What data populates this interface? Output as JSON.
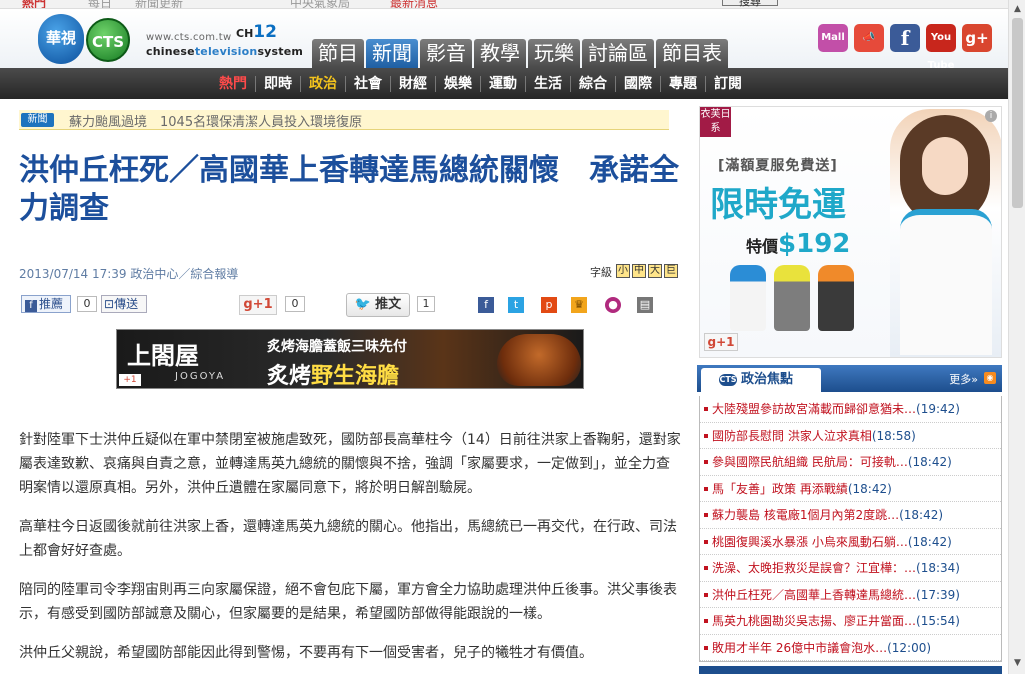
{
  "top_strip": {
    "items": [
      "熱門",
      "每日",
      "新聞更新",
      "中央氣象局",
      "最新消息"
    ],
    "search_label": "搜尋"
  },
  "logo": {
    "huashi": "華視",
    "cts": "CTS",
    "url": "www.cts.com.tw",
    "channel_prefix": "CH",
    "channel_number": "12",
    "name_prefix": "chinese",
    "name_mid": "television",
    "name_suffix": "system"
  },
  "main_tabs": [
    "節目",
    "新聞",
    "影音",
    "教學",
    "玩樂",
    "討論區",
    "節目表"
  ],
  "active_tab": "新聞",
  "social": {
    "mall": "Mall",
    "horn": "📣",
    "fb": "f",
    "yt": "You Tube",
    "gp": "g+"
  },
  "sub_nav": [
    "熱門",
    "即時",
    "政治",
    "社會",
    "財經",
    "娛樂",
    "運動",
    "生活",
    "綜合",
    "國際",
    "專題",
    "訂閱"
  ],
  "ticker": {
    "badge": "新聞",
    "text": "蘇力颱風過境　1045名環保清潔人員投入環境復原"
  },
  "article": {
    "headline": "洪仲丘枉死／高國華上香轉達馬總統關懷　承諾全力調查",
    "meta": "2013/07/14 17:39 政治中心／綜合報導",
    "font_label": "字級",
    "font_sizes": [
      "小",
      "中",
      "大",
      "巨"
    ],
    "fb_label": "推薦",
    "fb_count": "0",
    "share_label": "傳送",
    "gplus_label": "+1",
    "gplus_count": "0",
    "tweet_label": "推文",
    "tweet_count": "1",
    "paragraphs": [
      "針對陸軍下士洪仲丘疑似在軍中禁閉室被施虐致死，國防部長高華柱今（14）日前往洪家上香鞠躬，還對家屬表達致歉、哀痛與自責之意，並轉達馬英九總統的關懷與不捨，強調「家屬要求，一定做到」，並全力查明案情以還原真相。另外，洪仲丘遺體在家屬同意下，將於明日解剖驗屍。",
      "高華柱今日返國後就前往洪家上香，還轉達馬英九總統的關心。他指出，馬總統已一再交代，在行政、司法上都會好好查處。",
      "陪同的陸軍司令李翔宙則再三向家屬保證，絕不會包庇下屬，軍方會全力協助處理洪仲丘後事。洪父事後表示，有感受到國防部誠意及關心，但家屬要的是結果，希望國防部做得能跟說的一樣。",
      "洪仲丘父親說，希望國防部能因此得到警惕，不要再有下一個受害者，兒子的犧牲才有價值。"
    ]
  },
  "banner": {
    "brand": "上閤屋",
    "brand_en": "JOGOYA",
    "line1": "炙烤海膽蓋飯三味先付",
    "line2_a": "炙烤",
    "line2_b": "野生海膽",
    "gplus": "+1"
  },
  "ad": {
    "tag": "衣芙日系",
    "line1": "[滿額夏服免費送]",
    "line2": "限時免運",
    "price_label": "特價",
    "price": "$192",
    "gplus": "+1",
    "info": "i"
  },
  "hot": {
    "title": "政治焦點",
    "more": "更多»",
    "items": [
      {
        "text": "大陸殘盟參訪故宮滿載而歸卻意猶未…",
        "time": "(19:42)"
      },
      {
        "text": "國防部長慰問 洪家人泣求真相",
        "time": "(18:58)"
      },
      {
        "text": "參與國際民航組織 民航局：可接軌…",
        "time": "(18:42)"
      },
      {
        "text": "馬「友善」政策 再添戰績",
        "time": "(18:42)"
      },
      {
        "text": "蘇力襲島 核電廠1個月內第2度跳…",
        "time": "(18:42)"
      },
      {
        "text": "桃園復興溪水暴漲 小烏來風動石躺…",
        "time": "(18:42)"
      },
      {
        "text": "洗澡、太晚拒救災是誤會？江宜樺：…",
        "time": "(18:34)"
      },
      {
        "text": "洪仲丘枉死／高國華上香轉達馬總統…",
        "time": "(17:39)"
      },
      {
        "text": "馬英九桃園勘災吳志揚、廖正井當面…",
        "time": "(15:54)"
      },
      {
        "text": "敗用才半年 26億中市議會泡水…",
        "time": "(12:00)"
      }
    ]
  },
  "colors": {
    "headline": "#1c4f9c",
    "nav_active": "#f3c31d",
    "nav_hot": "#ff4a4a",
    "hot_link": "#c1121f",
    "hot_time": "#1d4e8d"
  }
}
